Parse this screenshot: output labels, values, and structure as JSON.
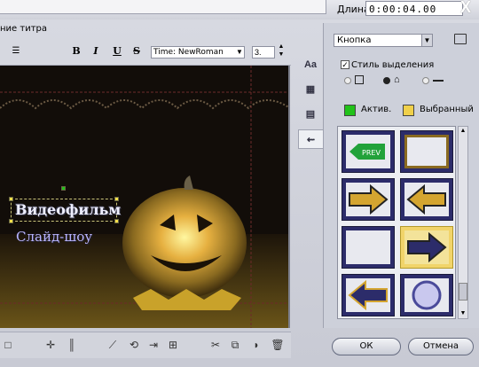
{
  "header": {
    "duration_label": "Длина",
    "duration_value": "0:00:04.00",
    "close": "X",
    "subtitle": "ние титра"
  },
  "toolbar": {
    "bold": "B",
    "italic": "I",
    "underline": "U",
    "strike": "S",
    "font": "Time: NewRoman",
    "size": "3."
  },
  "canvas": {
    "title": "Видеофильм",
    "subtitle": "Слайд-шоу"
  },
  "side_tabs": [
    "Aa",
    "▦",
    "▤",
    "⇜"
  ],
  "panel": {
    "dropdown": "Кнопка",
    "selection_style": "Стиль выделения",
    "active_label": "Актив.",
    "selected_label": "Выбранный",
    "active_color": "#22c21a",
    "selected_color": "#f0d04a"
  },
  "gallery": {
    "prev_label": "PREV"
  },
  "buttons": {
    "ok": "ОК",
    "cancel": "Отмена"
  }
}
